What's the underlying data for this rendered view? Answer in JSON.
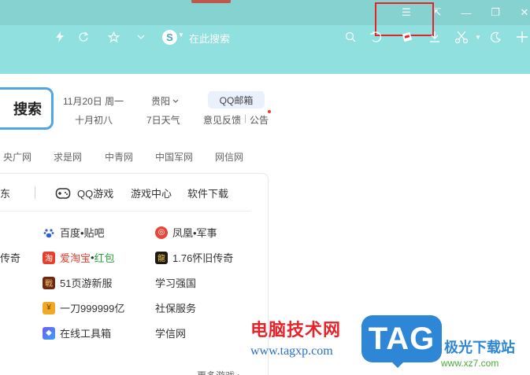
{
  "browser": {
    "search_text": "在此搜索",
    "icons": {
      "back": "back-arrow-icon",
      "refresh": "refresh-icon",
      "star": "star-icon",
      "star_dropdown": "chevron-down-icon",
      "search_engine": "sogou-logo-icon",
      "menu": "hamburger-menu-icon"
    },
    "window": {
      "menu": "☰",
      "pin": "⇱",
      "minimize": "—",
      "restore": "❐",
      "close": "✕"
    },
    "tools": {
      "search": "⌕",
      "undo": "↶",
      "screenshot": "▣",
      "download": "⤓",
      "scissors": "✂",
      "moon": "☾",
      "add": "+"
    }
  },
  "header": {
    "search_button": "搜索",
    "date": "11月20日 周一",
    "lunar": "十月初八",
    "city": "贵阳",
    "weather": "7日天气",
    "mail": "QQ邮箱",
    "feedback": "意见反馈",
    "separator": "|",
    "notice": "公告"
  },
  "nav_links": [
    "央广网",
    "求是网",
    "中青网",
    "中国军网",
    "网信网"
  ],
  "card": {
    "left_cut": "东",
    "tabs": [
      "QQ游戏",
      "游戏中心",
      "软件下载"
    ],
    "links": {
      "col1_r2": "传奇",
      "r1a": "百度•贴吧",
      "r1b": "凤凰•军事",
      "r2a": "爱淘宝",
      "r2a_dot": "•",
      "r2a_suffix": "红包",
      "r2b": "1.76怀旧传奇",
      "r3a": "51页游新服",
      "r3b": "学习强国",
      "r4a": "一刀999999亿",
      "r4b": "社保服务",
      "r5a": "在线工具箱",
      "r5b": "学信网",
      "more": "更多游戏 ›"
    },
    "colors": {
      "taobao_red": "#e5402e",
      "green_text": "#2aa33d"
    }
  },
  "watermark": {
    "cn": "电脑技术网",
    "url": "www.tagxp.com",
    "tag": "TAG",
    "site": "极光下载站",
    "site_url": "www.xz7.com"
  },
  "colors": {
    "chrome": "#8fe0de",
    "highlight_box": "#e4222b",
    "search_border": "#4ea7e3"
  }
}
